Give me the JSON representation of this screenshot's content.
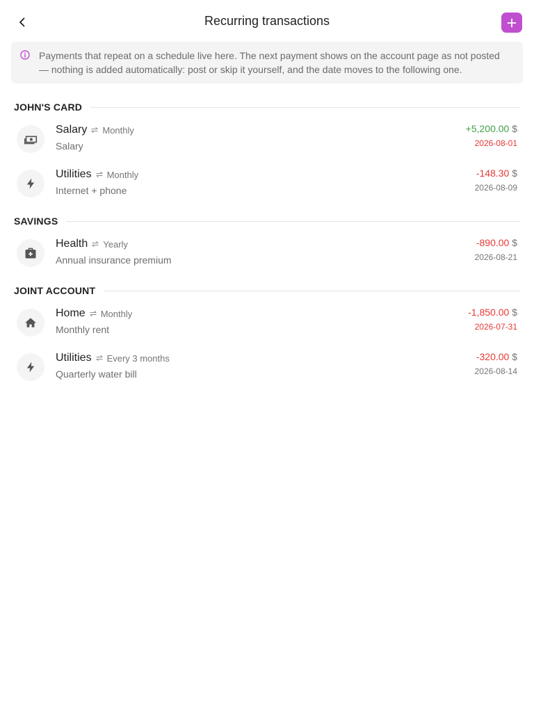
{
  "header": {
    "title": "Recurring transactions",
    "back_icon": "chevron-left-icon",
    "add_icon": "plus-icon",
    "accent_color": "#c04fd0"
  },
  "info": {
    "icon": "info-icon",
    "text": "Payments that repeat on a schedule live here. The next payment shows on the account page as not posted — nothing is added automatically: post or skip it yourself, and the date moves to the following one."
  },
  "colors": {
    "positive": "#43a047",
    "negative": "#e53935",
    "date_overdue": "#e53935",
    "date_normal": "#757575"
  },
  "sections": [
    {
      "title": "JOHN'S CARD",
      "items": [
        {
          "name": "Salary",
          "frequency": "Monthly",
          "description": "Salary",
          "amount": "+5,200.00",
          "currency": "$",
          "date": "2026-08-01",
          "icon": "cash-icon"
        },
        {
          "name": "Utilities",
          "frequency": "Monthly",
          "description": "Internet + phone",
          "amount": "-148.30",
          "currency": "$",
          "date": "2026-08-09",
          "icon": "lightning-icon"
        }
      ]
    },
    {
      "title": "SAVINGS",
      "items": [
        {
          "name": "Health",
          "frequency": "Yearly",
          "description": "Annual insurance premium",
          "amount": "-890.00",
          "currency": "$",
          "date": "2026-08-21",
          "icon": "medical-bag-icon"
        }
      ]
    },
    {
      "title": "JOINT ACCOUNT",
      "items": [
        {
          "name": "Home",
          "frequency": "Monthly",
          "description": "Monthly rent",
          "amount": "-1,850.00",
          "currency": "$",
          "date": "2026-07-31",
          "icon": "home-icon"
        },
        {
          "name": "Utilities",
          "frequency": "Every 3 months",
          "description": "Quarterly water bill",
          "amount": "-320.00",
          "currency": "$",
          "date": "2026-08-14",
          "icon": "lightning-icon"
        }
      ]
    }
  ]
}
